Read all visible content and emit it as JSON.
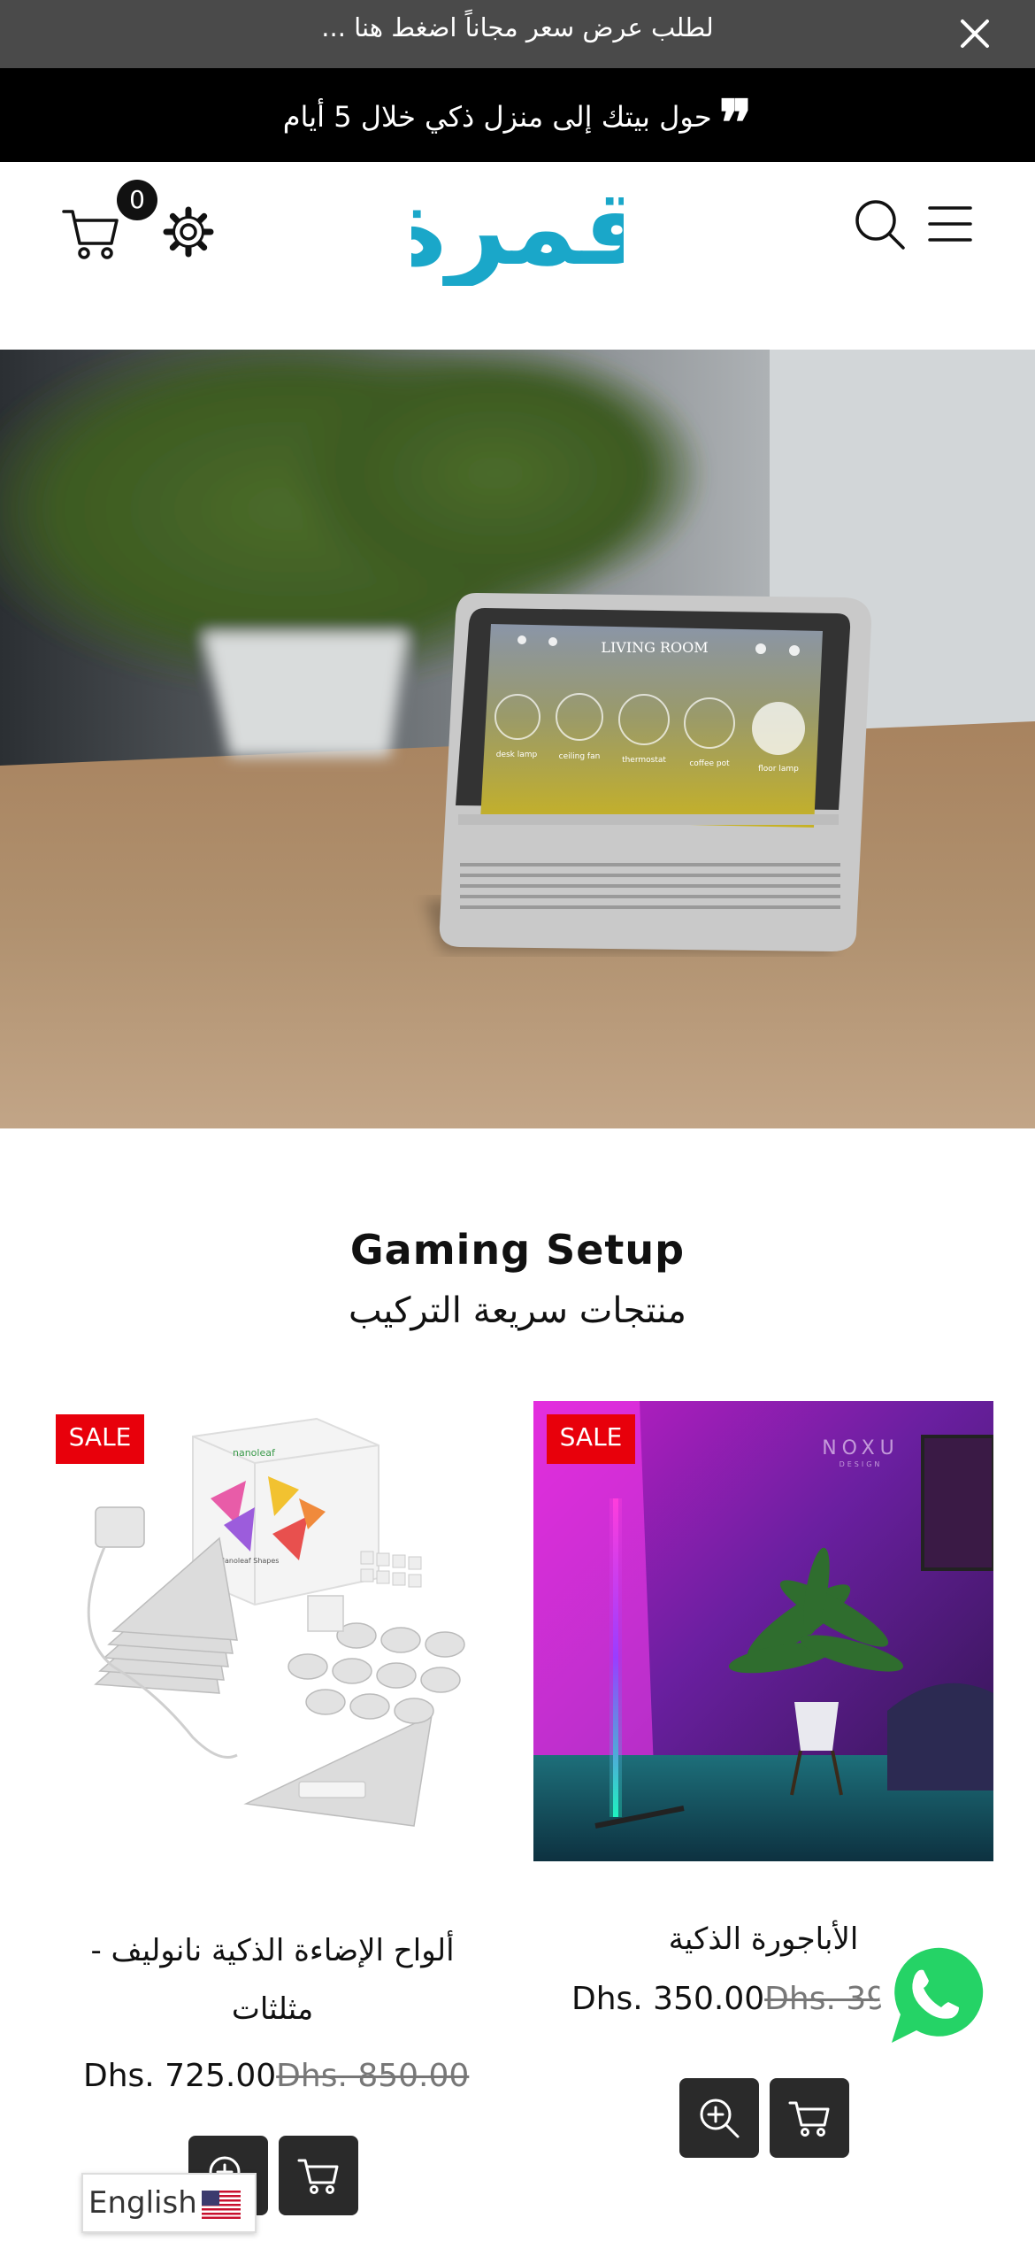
{
  "announcement": {
    "text": "لطلب عرض سعر مجاناً اضغط هنا ...",
    "close_icon": "close-icon"
  },
  "quote_bar": {
    "text": "حول بيتك إلى منزل ذكي خلال 5 أيام",
    "quote_mark": "❞"
  },
  "header": {
    "logo_text": "قمرة",
    "logo_color": "#1aa7c9",
    "cart_count": "0",
    "icons": [
      "menu-icon",
      "search-icon",
      "gear-icon",
      "cart-icon"
    ]
  },
  "section": {
    "title": "Gaming Setup",
    "subtitle": "منتجات سريعة التركيب"
  },
  "products": [
    {
      "badge": "SALE",
      "name": "الأباجورة الذكية",
      "price": "Dhs. 350.00",
      "old_price": "Dhs. 39"
    },
    {
      "badge": "SALE",
      "name": "ألواح الإضاءة الذكية نانوليف - مثلثات",
      "price": "Dhs. 725.00",
      "old_price": "Dhs. 850.00"
    }
  ],
  "hero": {
    "screen_title": "LIVING ROOM",
    "devices": [
      "desk lamp",
      "ceiling fan",
      "thermostat",
      "coffee pot",
      "floor lamp"
    ]
  },
  "product_image_text": {
    "brand": "NOXU",
    "brand_sub": "DESIGN",
    "box_brand": "nanoleaf",
    "box_line": "Nanoleaf Shapes"
  },
  "language": {
    "label": "English"
  },
  "colors": {
    "sale": "#e8000b",
    "whatsapp": "#25d366"
  }
}
